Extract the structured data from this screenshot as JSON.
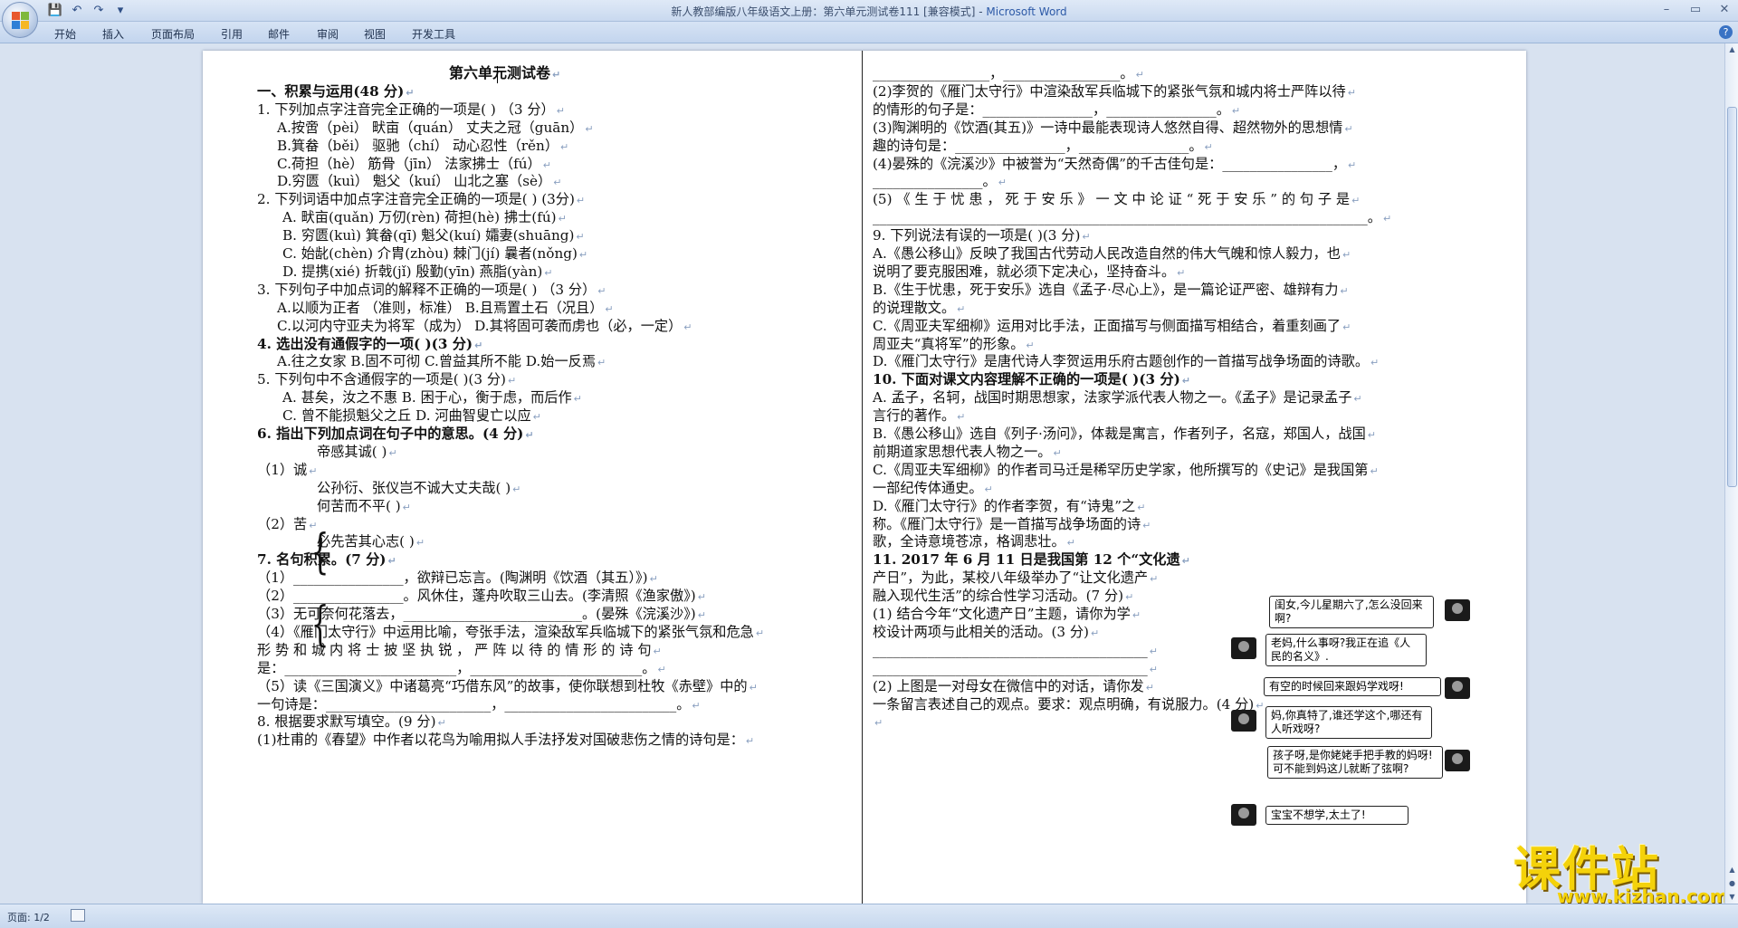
{
  "window": {
    "title": "新人教部编版八年级语文上册：第六单元测试卷111 [兼容模式] - ",
    "app_name": "Microsoft Word",
    "controls": [
      "–",
      "▭",
      "✕"
    ]
  },
  "qat": {
    "save_icon": "💾",
    "undo_icon": "↶",
    "redo_icon": "↷",
    "more_icon": "▾"
  },
  "ribbon": {
    "tabs": [
      "开始",
      "插入",
      "页面布局",
      "引用",
      "邮件",
      "审阅",
      "视图",
      "开发工具"
    ],
    "help_icon": "?"
  },
  "document": {
    "left_lines": [
      {
        "t": "第六单元测试卷",
        "cls": "title"
      },
      {
        "t": "一、积累与运用(48 分)",
        "cls": "bold"
      },
      {
        "t": "1. 下列加点字注音完全正确的一项是(      ) （3 分）"
      },
      {
        "t": "A.按啻（pèi）              畎亩（quán）              丈夫之冠（guān）"
      },
      {
        "t": "B.箕畚（běi）              驱驰（chí）               动心忍性（rěn）"
      },
      {
        "t": "C.荷担（hè）               筋骨（jīn）               法家拂士（fú）"
      },
      {
        "t": "D.穷匮（kuì）              魁父（kuí）               山北之塞（sè）"
      },
      {
        "t": "2. 下列词语中加点字注音完全正确的一项是(      ) (3分)"
      },
      {
        "t": "A. 畎亩(quǎn)      万仞(rèn)       荷担(hè)       拂士(fú)"
      },
      {
        "t": "B. 穷匮(kuì)      箕畚(qī)    魁父(kuí)    孀妻(shuāng)"
      },
      {
        "t": "C. 始龀(chèn)    介胄(zhòu)    棘门(jí)    曩者(nǒng)"
      },
      {
        "t": "D. 提携(xié)     折戟(jǐ)    殷勤(yīn)    燕脂(yàn)"
      },
      {
        "t": "3. 下列句子中加点词的解释不正确的一项是(        ) （3 分）"
      },
      {
        "t": "A.以顺为正者 （准则，标准）          B.且焉置土石（况且）"
      },
      {
        "t": "C.以河内守亚夫为将军（成为）        D.其将固可袭而虏也（必，一定）"
      },
      {
        "t": "4. 选出没有通假字的一项(        )(3 分)",
        "cls": "bold"
      },
      {
        "t": "A.往之女家       B.固不可彻      C.曾益其所不能        D.始一反焉"
      },
      {
        "t": "5. 下列句中不含通假字的一项是(      )(3 分)"
      },
      {
        "t": "A. 甚矣，汝之不惠          B. 困于心，衡于虑，而后作"
      },
      {
        "t": "C. 曾不能损魁父之丘        D. 河曲智叟亡以应"
      },
      {
        "t": "6. 指出下列加点词在句子中的意思。(4 分)",
        "cls": "bold"
      },
      {
        "t": "帝感其诚(      )"
      },
      {
        "t": "（1）诚"
      },
      {
        "t": "公孙衍、张仪岂不诚大丈夫哉(                                     )"
      },
      {
        "t": "何苦而不平(                                  )"
      },
      {
        "t": "（2）苦"
      },
      {
        "t": "必先苦其心志(                                    )"
      },
      {
        "t": "7. 名句积累。(7 分)",
        "cls": "bold"
      },
      {
        "t": "（1）________________，欲辩已忘言。(陶渊明《饮酒（其五）》)"
      },
      {
        "t": "（2）________________。风休住，蓬舟吹取三山去。(李清照《渔家傲》)"
      },
      {
        "t": "（3）无可奈何花落去，__________________________。(晏殊《浣溪沙》)"
      },
      {
        "t": "（4）《雁门太守行》中运用比喻，夸张手法，渲染敌军兵临城下的紧张气氛和危急"
      },
      {
        "t": "     形 势 和 城 内 将 士 披 坚 执 锐 ， 严 阵 以 待 的 情 形 的 诗 句"
      },
      {
        "t": "     是：_________________________，_________________________。"
      },
      {
        "t": "（5）读《三国演义》中诸葛亮“巧借东风”的故事，使你联想到杜牧《赤壁》中的"
      },
      {
        "t": "     一句诗是：________________________，_________________________。"
      },
      {
        "t": "8. 根据要求默写填空。(9 分)"
      },
      {
        "t": "  (1)杜甫的《春望》中作者以花鸟为喻用拟人手法抒发对国破悲伤之情的诗句是："
      }
    ],
    "right_lines": [
      {
        "t": "_________________，_________________。"
      },
      {
        "t": "  (2)李贺的《雁门太守行》中渲染敌军兵临城下的紧张气氛和城内将士严阵以待"
      },
      {
        "t": "的情形的句子是：________________，________________。"
      },
      {
        "t": "  (3)陶渊明的《饮酒(其五)》一诗中最能表现诗人悠然自得、超然物外的思想情"
      },
      {
        "t": "趣的诗句是：________________，________________。"
      },
      {
        "t": "  (4)晏殊的《浣溪沙》中被誉为“天然奇偶”的千古佳句是：________________，"
      },
      {
        "t": "________________。"
      },
      {
        "t": "  (5) 《 生 于 忧 患 ， 死 于 安 乐 》 一 文 中 论 证 “ 死 于 安 乐 ” 的 句 子 是"
      },
      {
        "t": "________________________________________________________________________。"
      },
      {
        "t": "9. 下列说法有误的一项是(      )(3 分)"
      },
      {
        "t": "  A.《愚公移山》反映了我国古代劳动人民改造自然的伟大气魄和惊人毅力，也"
      },
      {
        "t": "说明了要克服困难，就必须下定决心，坚持奋斗。"
      },
      {
        "t": "  B.《生于忧患，死于安乐》选自《孟子·尽心上》，是一篇论证严密、雄辩有力"
      },
      {
        "t": "的说理散文。"
      },
      {
        "t": "  C.《周亚夫军细柳》运用对比手法，正面描写与侧面描写相结合，着重刻画了"
      },
      {
        "t": "周亚夫“真将军”的形象。"
      },
      {
        "t": "D.《雁门太守行》是唐代诗人李贺运用乐府古题创作的一首描写战争场面的诗歌。"
      },
      {
        "t": "10. 下面对课文内容理解不正确的一项是(          )(3 分)",
        "cls": "bold"
      },
      {
        "t": "  A. 孟子，名轲，战国时期思想家，法家学派代表人物之一。《孟子》是记录孟子"
      },
      {
        "t": "言行的著作。"
      },
      {
        "t": "B.《愚公移山》选自《列子·汤问》，体裁是寓言，作者列子，名寇，郑国人，战国"
      },
      {
        "t": "  前期道家思想代表人物之一。"
      },
      {
        "t": "C.《周亚夫军细柳》的作者司马迁是稀罕历史学家，他所撰写的《史记》是我国第"
      },
      {
        "t": "  一部纪传体通史。"
      },
      {
        "t": "D.《雁门太守行》的作者李贺，有“诗鬼”之"
      },
      {
        "t": "  称。《雁门太守行》是一首描写战争场面的诗"
      },
      {
        "t": "  歌，全诗意境苍凉，格调悲壮。"
      },
      {
        "t": "11. 2017 年 6 月 11 日是我国第 12 个“文化遗",
        "cls": "bold"
      },
      {
        "t": "产日”，为此，某校八年级举办了“让文化遗产"
      },
      {
        "t": "融入现代生活”的综合性学习活动。(7 分)"
      },
      {
        "t": "(1) 结合今年“文化遗产日”主题，请你为学"
      },
      {
        "t": "校设计两项与此相关的活动。(3 分)"
      },
      {
        "t": "________________________________________"
      },
      {
        "t": "________________________________________"
      },
      {
        "t": "(2) 上图是一对母女在微信中的对话，请你发"
      },
      {
        "t": "一条留言表述自己的观点。要求：观点明确，有说服力。(4 分)"
      },
      {
        "t": ""
      }
    ],
    "chat": [
      "闺女,今儿星期六了,怎么没回来啊?",
      "老妈,什么事呀?我正在追《人民的名义》.",
      "有空的时候回来跟妈学戏呀!",
      "妈,你真特了,谁还学这个,哪还有人听戏呀?",
      "孩子呀,是你姥姥手把手教的妈呀! 可不能到妈这儿就断了弦啊?",
      "宝宝不想学,太土了!"
    ],
    "paragraph_mark": "↵"
  },
  "watermark": {
    "big": "课件站",
    "small": "www.kjzhan.com"
  },
  "status": {
    "page": "页面: 1/2"
  }
}
